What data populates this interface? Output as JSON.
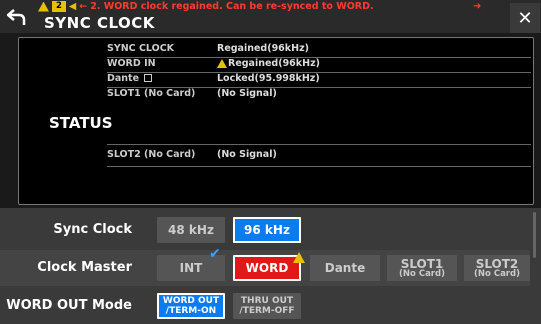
{
  "header": {
    "title": "SYNC CLOCK",
    "alert_count": "2",
    "alert_message": "2. WORD clock regained. Can be re-synced to WORD.",
    "close_glyph": "✕"
  },
  "status": {
    "label": "STATUS",
    "rows": [
      {
        "key": "SYNC CLOCK",
        "value": "Regained(96kHz)"
      },
      {
        "key": "WORD IN",
        "value": "Regained(96kHz)"
      },
      {
        "key": "Dante",
        "value": "Locked(95.998kHz)"
      },
      {
        "key": "SLOT1 (No Card)",
        "value": "(No Signal)"
      },
      {
        "key": "SLOT2 (No Card)",
        "value": "(No Signal)"
      }
    ]
  },
  "settings": {
    "sync_clock": {
      "label": "Sync Clock",
      "options": [
        "48 kHz",
        "96 kHz"
      ],
      "selected": "96 kHz"
    },
    "clock_master": {
      "label": "Clock Master",
      "int": "INT",
      "word": "WORD",
      "dante": "Dante",
      "slot1_main": "SLOT1",
      "slot1_sub": "(No Card)",
      "slot2_main": "SLOT2",
      "slot2_sub": "(No Card)",
      "selected": "WORD"
    },
    "word_out": {
      "label": "WORD OUT Mode",
      "opt1_main": "WORD OUT",
      "opt1_sub": "/TERM-ON",
      "opt2_main": "THRU OUT",
      "opt2_sub": "/TERM-OFF",
      "selected": "WORD OUT /TERM-ON"
    }
  },
  "colors": {
    "accent_blue": "#0a7cf0",
    "alert_red": "#e01818",
    "warning_yellow": "#e8c000"
  }
}
